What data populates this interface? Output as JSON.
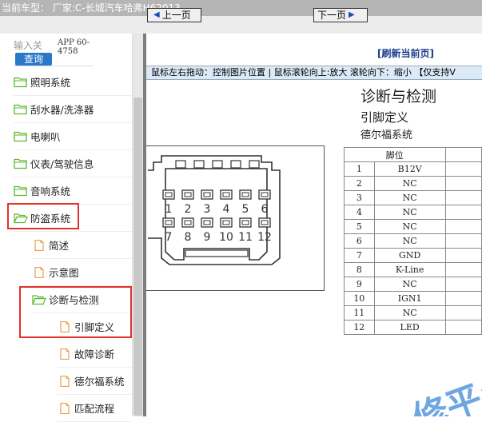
{
  "topbar": {
    "text": "当前车型： 厂家:C-长城汽车哈弗H62013"
  },
  "search": {
    "hint": "输入关",
    "button": "查询",
    "app_line1": "APP 60-",
    "app_line2": "4758"
  },
  "tree": {
    "items": [
      {
        "label": "照明系统",
        "icon": "folder"
      },
      {
        "label": "刮水器/洗涤器",
        "icon": "folder"
      },
      {
        "label": "电喇叭",
        "icon": "folder"
      },
      {
        "label": "仪表/驾驶信息",
        "icon": "folder"
      },
      {
        "label": "音响系统",
        "icon": "folder"
      },
      {
        "label": "防盗系统",
        "icon": "folder-open"
      },
      {
        "label": "简述",
        "icon": "file"
      },
      {
        "label": "示意图",
        "icon": "file"
      },
      {
        "label": "诊断与检测",
        "icon": "folder-open"
      },
      {
        "label": "引脚定义",
        "icon": "file"
      },
      {
        "label": "故障诊断",
        "icon": "file"
      },
      {
        "label": "德尔福系统",
        "icon": "file"
      },
      {
        "label": "匹配流程",
        "icon": "file"
      }
    ]
  },
  "nav": {
    "prev": "上一页",
    "next": "下一页",
    "refresh": "[刷新当前页]"
  },
  "hint": {
    "text": "鼠标左右拖动：控制图片位置 | 鼠标滚轮向上:放大  滚轮向下：缩小 【仅支持V"
  },
  "doc": {
    "title": "诊断与检测",
    "sub1": "引脚定义",
    "sub2": "德尔福系统",
    "connector_top": [
      "1",
      "2",
      "3",
      "4",
      "5",
      "6"
    ],
    "connector_bottom": [
      "7",
      "8",
      "9",
      "10",
      "11",
      "12"
    ],
    "table_header": "脚位",
    "pins": [
      {
        "num": "1",
        "name": "B12V"
      },
      {
        "num": "2",
        "name": "NC"
      },
      {
        "num": "3",
        "name": "NC"
      },
      {
        "num": "4",
        "name": "NC"
      },
      {
        "num": "5",
        "name": "NC"
      },
      {
        "num": "6",
        "name": "NC"
      },
      {
        "num": "7",
        "name": "GND"
      },
      {
        "num": "8",
        "name": "K-Line"
      },
      {
        "num": "9",
        "name": "NC"
      },
      {
        "num": "10",
        "name": "IGN1"
      },
      {
        "num": "11",
        "name": "NC"
      },
      {
        "num": "12",
        "name": "LED"
      }
    ],
    "watermark": "修平台"
  },
  "colors": {
    "highlight": "#e0312d",
    "folder": "#5cb82a",
    "file": "#e8a14a",
    "search_button": "#2a78c8"
  }
}
